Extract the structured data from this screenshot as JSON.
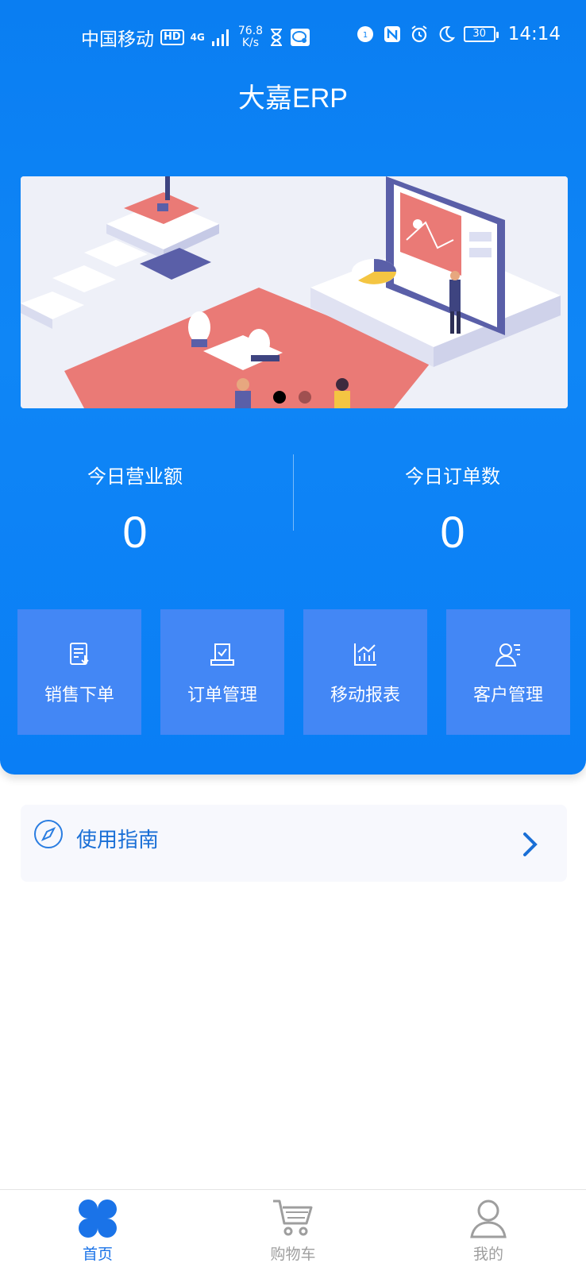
{
  "status_bar": {
    "carrier": "中国移动",
    "hd_badge": "HD",
    "network": "4G",
    "speed_value": "76.8",
    "speed_unit": "K/s",
    "battery_level": "30",
    "time": "14:14"
  },
  "app": {
    "title": "大嘉ERP"
  },
  "banner": {
    "total_slides": 2,
    "active_slide": 1,
    "active_dot_color": "#000000",
    "inactive_dot_color": "#a05050"
  },
  "stats": {
    "revenue_label": "今日营业额",
    "revenue_value": "0",
    "orders_label": "今日订单数",
    "orders_value": "0"
  },
  "menu": {
    "items": [
      {
        "label": "销售下单",
        "icon": "sales-order-icon"
      },
      {
        "label": "订单管理",
        "icon": "order-management-icon"
      },
      {
        "label": "移动报表",
        "icon": "report-chart-icon"
      },
      {
        "label": "客户管理",
        "icon": "customer-management-icon"
      }
    ]
  },
  "guide": {
    "label": "使用指南",
    "icon": "compass-icon"
  },
  "tabbar": {
    "active_color": "#1a73e8",
    "inactive_color": "#9e9e9e",
    "items": [
      {
        "label": "首页",
        "icon": "home-grid-icon",
        "active": true
      },
      {
        "label": "购物车",
        "icon": "cart-icon",
        "active": false
      },
      {
        "label": "我的",
        "icon": "user-icon",
        "active": false
      }
    ]
  }
}
